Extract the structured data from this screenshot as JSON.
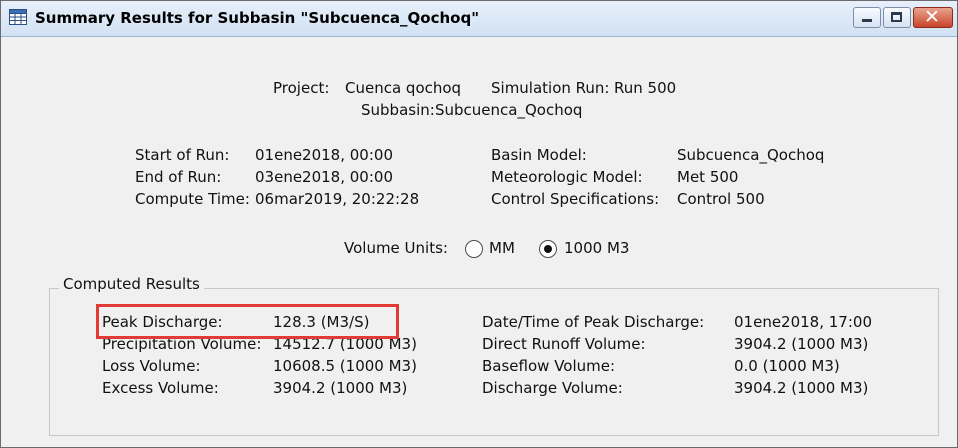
{
  "window": {
    "title": "Summary Results for Subbasin \"Subcuenca_Qochoq\"",
    "icon": "table-grid-icon",
    "controls": [
      "minimize-icon",
      "maximize-icon",
      "close-icon"
    ]
  },
  "header": {
    "project_label": "Project:",
    "project_value": "Cuenca qochoq",
    "simrun_label": "Simulation Run:",
    "simrun_value": "Run 500",
    "subbasin_label": "Subbasin:",
    "subbasin_value": "Subcuenca_Qochoq"
  },
  "run_info": {
    "start_label": "Start of Run:",
    "start_value": "01ene2018, 00:00",
    "end_label": "End of Run:",
    "end_value": "03ene2018, 00:00",
    "compute_label": "Compute Time:",
    "compute_value": "06mar2019, 20:22:28",
    "basin_label": "Basin Model:",
    "basin_value": "Subcuenca_Qochoq",
    "met_label": "Meteorologic Model:",
    "met_value": "Met 500",
    "control_label": "Control Specifications:",
    "control_value": "Control 500"
  },
  "volume_units": {
    "label": "Volume Units:",
    "options": [
      "MM",
      "1000 M3"
    ],
    "selected": "1000 M3"
  },
  "computed_results": {
    "legend": "Computed Results",
    "left": [
      {
        "label": "Peak Discharge:",
        "value": "128.3 (M3/S)"
      },
      {
        "label": "Precipitation Volume:",
        "value": "14512.7 (1000 M3)"
      },
      {
        "label": "Loss Volume:",
        "value": "10608.5 (1000 M3)"
      },
      {
        "label": "Excess Volume:",
        "value": "3904.2 (1000 M3)"
      }
    ],
    "right": [
      {
        "label": "Date/Time of Peak Discharge:",
        "value": "01ene2018, 17:00"
      },
      {
        "label": "Direct Runoff Volume:",
        "value": "3904.2 (1000 M3)"
      },
      {
        "label": "Baseflow Volume:",
        "value": "0.0 (1000 M3)"
      },
      {
        "label": "Discharge Volume:",
        "value": "3904.2 (1000 M3)"
      }
    ]
  },
  "highlight_color": "#e03b34"
}
